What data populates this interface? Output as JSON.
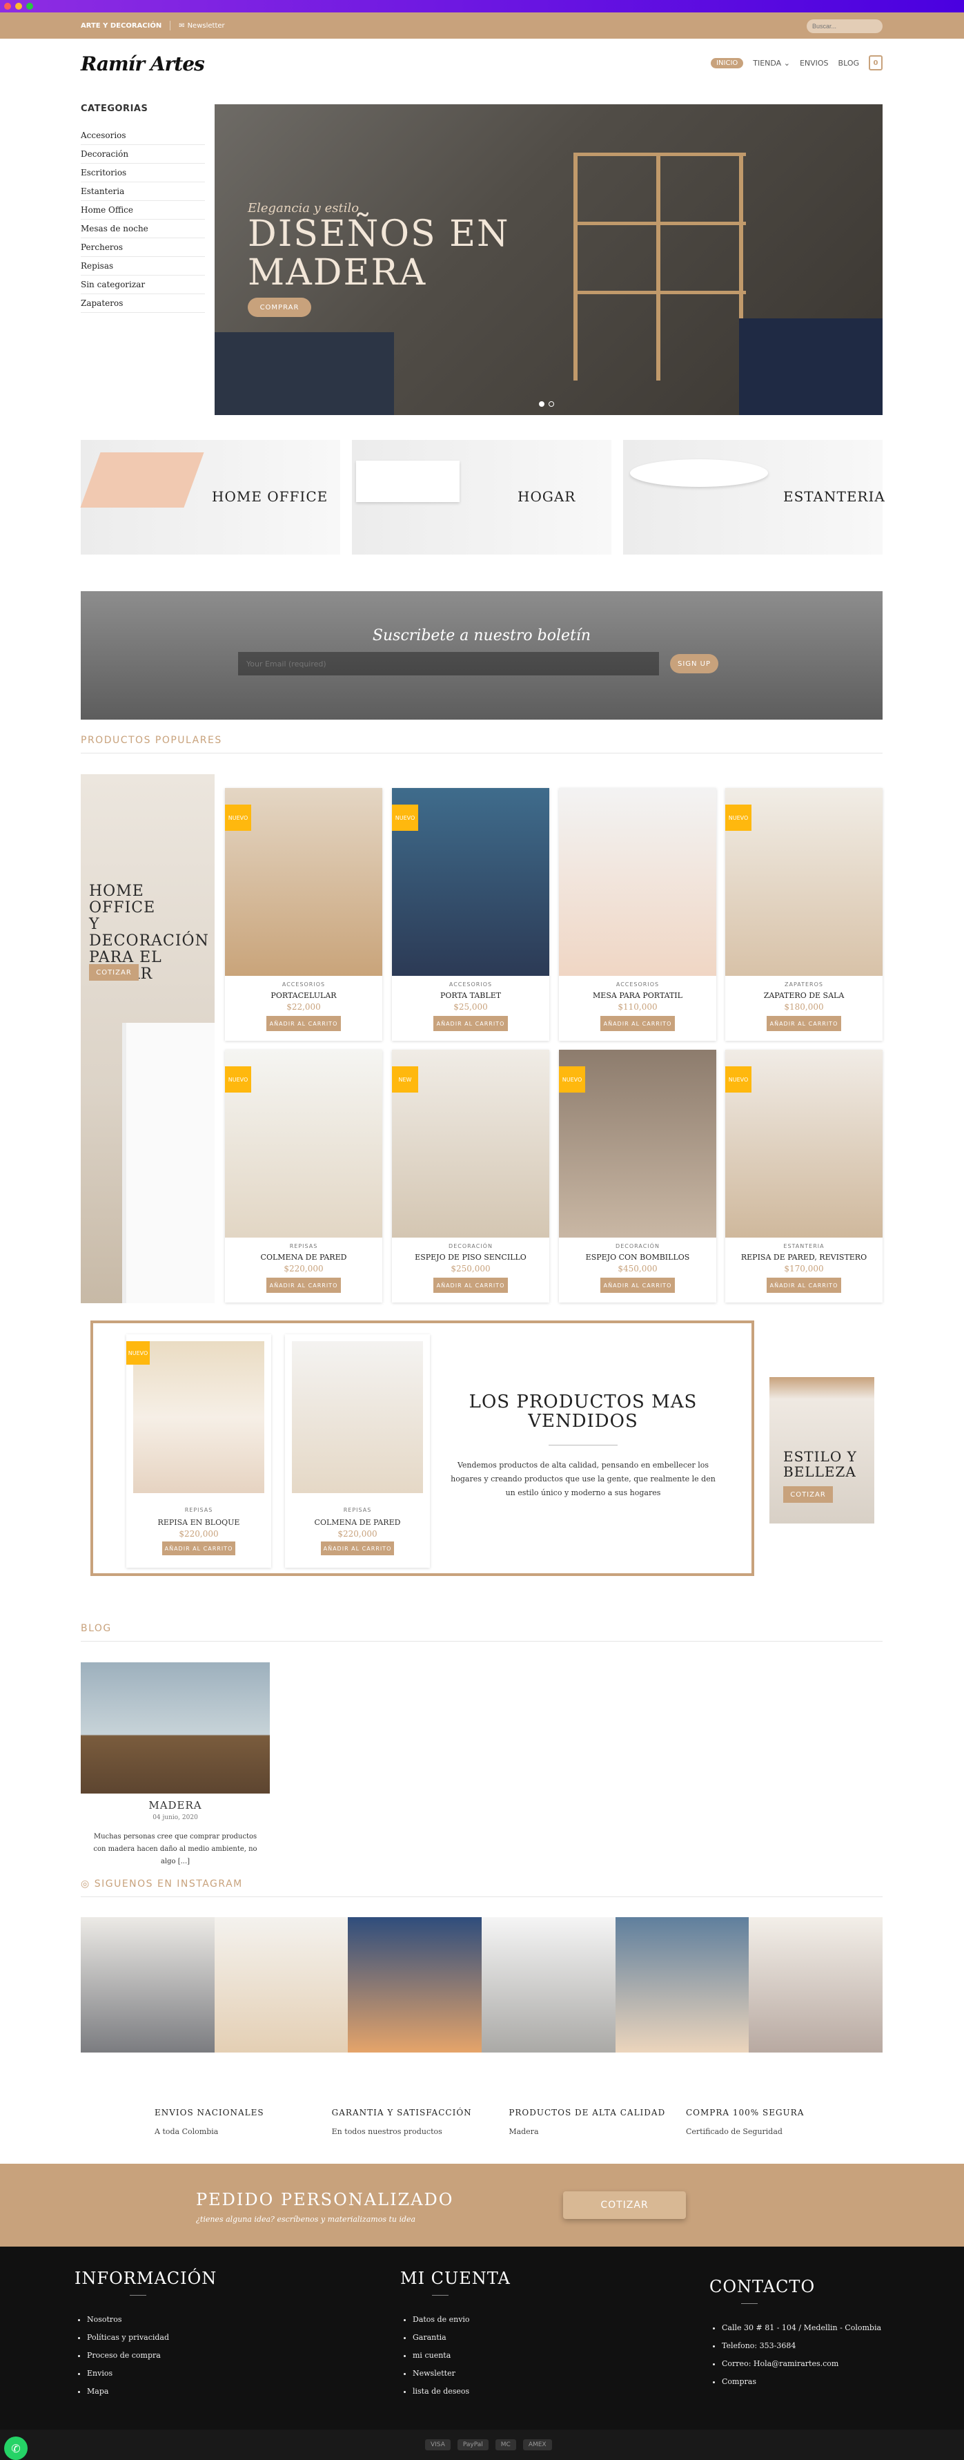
{
  "topbar": {
    "title": "ARTE Y DECORACIÓN",
    "newsletter": "Newsletter",
    "search_placeholder": "Buscar..."
  },
  "header": {
    "logo": "Ramír Artes",
    "nav": [
      "INICIO",
      "TIENDA",
      "ENVIOS",
      "BLOG"
    ],
    "cart_count": "0"
  },
  "sidebar": {
    "title": "CATEGORIAS",
    "items": [
      "Accesorios",
      "Decoración",
      "Escritorios",
      "Estanteria",
      "Home Office",
      "Mesas de noche",
      "Percheros",
      "Repisas",
      "Sin categorizar",
      "Zapateros"
    ]
  },
  "hero": {
    "subtitle": "Elegancia y estilo",
    "title_line1": "DISEÑOS EN",
    "title_line2": "MADERA",
    "button": "COMPRAR"
  },
  "categories": [
    "HOME OFFICE",
    "HOGAR",
    "ESTANTERIA"
  ],
  "newsletter": {
    "title": "Suscribete a nuestro boletín",
    "placeholder": "Your Email (required)",
    "button": "SIGN UP"
  },
  "popular": {
    "heading": "PRODUCTOS POPULARES",
    "promo_title_l1": "HOME OFFICE",
    "promo_title_l2": "Y",
    "promo_title_l3": "DECORACIÓN",
    "promo_title_l4": "PARA EL",
    "promo_title_l5": "HOGAR",
    "promo_button": "COTIZAR",
    "add_to_cart": "AÑADIR AL CARRITO",
    "products": [
      {
        "badge": "NUEVO",
        "cat": "ACCESORIOS",
        "name": "PORTACELULAR",
        "price": "$22,000"
      },
      {
        "badge": "NUEVO",
        "cat": "ACCESORIOS",
        "name": "PORTA TABLET",
        "price": "$25,000"
      },
      {
        "badge": "",
        "cat": "ACCESORIOS",
        "name": "MESA PARA PORTATIL",
        "price": "$110,000"
      },
      {
        "badge": "NUEVO",
        "cat": "ZAPATEROS",
        "name": "ZAPATERO DE SALA",
        "price": "$180,000"
      },
      {
        "badge": "NUEVO",
        "cat": "REPISAS",
        "name": "COLMENA DE PARED",
        "price": "$220,000"
      },
      {
        "badge": "NEW",
        "cat": "DECORACIÓN",
        "name": "ESPEJO DE PISO SENCILLO",
        "price": "$250,000"
      },
      {
        "badge": "NUEVO",
        "cat": "DECORACIÓN",
        "name": "ESPEJO CON BOMBILLOS",
        "price": "$450,000"
      },
      {
        "badge": "NUEVO",
        "cat": "ESTANTERIA",
        "name": "REPISA DE PARED, REVISTERO",
        "price": "$170,000"
      }
    ]
  },
  "bestsellers": {
    "title_l1": "LOS PRODUCTOS MAS",
    "title_l2": "VENDIDOS",
    "description": "Vendemos productos de alta calidad, pensando en embellecer los hogares y creando productos que use la gente, que realmente le den un estilo único y moderno a sus hogares",
    "products": [
      {
        "badge": "NUEVO",
        "cat": "REPISAS",
        "name": "REPISA EN BLOQUE",
        "price": "$220,000"
      },
      {
        "badge": "",
        "cat": "REPISAS",
        "name": "COLMENA DE PARED",
        "price": "$220,000"
      }
    ],
    "beauty_l1": "ESTILO Y",
    "beauty_l2": "BELLEZA",
    "beauty_button": "COTIZAR"
  },
  "blog": {
    "heading": "BLOG",
    "post_title": "MADERA",
    "post_date": "04 junio, 2020",
    "post_excerpt": "Muchas personas cree que comprar productos con madera hacen daño al medio ambiente, no algo [...]"
  },
  "instagram": {
    "heading": "SIGUENOS EN INSTAGRAM"
  },
  "features": [
    {
      "title": "ENVIOS NACIONALES",
      "desc": "A toda Colombia"
    },
    {
      "title": "GARANTIA Y SATISFACCIÓN",
      "desc": "En todos nuestros productos"
    },
    {
      "title": "PRODUCTOS DE ALTA CALIDAD",
      "desc": "Madera"
    },
    {
      "title": "COMPRA 100% SEGURA",
      "desc": "Certificado de Seguridad"
    }
  ],
  "custom_order": {
    "title": "PEDIDO PERSONALIZADO",
    "subtitle": "¿tienes alguna idea? escríbenos y materializamos tu idea",
    "button": "COTIZAR"
  },
  "footer": {
    "info_title": "INFORMACIÓN",
    "info_items": [
      "Nosotros",
      "Políticas y privacidad",
      "Proceso de compra",
      "Envios",
      "Mapa"
    ],
    "account_title": "MI CUENTA",
    "account_items": [
      "Datos de envio",
      "Garantia",
      "mi cuenta",
      "Newsletter",
      "lista de deseos"
    ],
    "contact_title": "CONTACTO",
    "contact_items": [
      "Calle 30 # 81 - 104 / Medellin - Colombia",
      "Telefono: 353-3684",
      "Correo: Hola@ramirartes.com",
      "Compras"
    ]
  },
  "payments": [
    "VISA",
    "PayPal",
    "MC",
    "AMEX"
  ]
}
